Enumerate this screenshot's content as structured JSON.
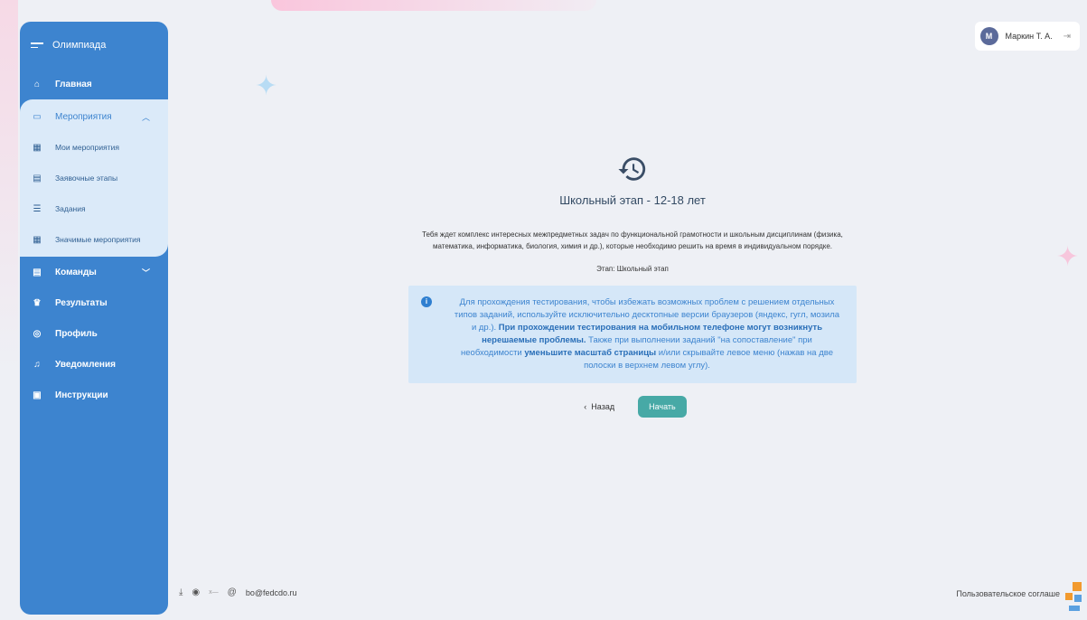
{
  "sidebar": {
    "app_title": "Олимпиада",
    "main_item": "Главная",
    "events": {
      "label": "Мероприятия",
      "sub_items": [
        {
          "label": "Мои мероприятия",
          "icon": "calendar-grid-icon"
        },
        {
          "label": "Заявочные этапы",
          "icon": "calendar-list-icon"
        },
        {
          "label": "Задания",
          "icon": "tasks-list-icon"
        },
        {
          "label": "Значимые мероприятия",
          "icon": "calendar-star-icon"
        }
      ]
    },
    "items": [
      {
        "label": "Команды",
        "icon": "team-icon"
      },
      {
        "label": "Результаты",
        "icon": "trophy-icon"
      },
      {
        "label": "Профиль",
        "icon": "profile-icon"
      },
      {
        "label": "Уведомления",
        "icon": "bell-icon"
      },
      {
        "label": "Инструкции",
        "icon": "book-icon"
      }
    ]
  },
  "header": {
    "user_initial": "М",
    "user_name": "Маркин Т. А."
  },
  "main": {
    "title": "Школьный этап - 12-18 лет",
    "description": "Тебя ждет комплекс интересных межпредметных задач по функциональной грамотности и школьным дисциплинам (физика, математика, информатика, биология, химия и др.), которые необходимо решить на время в индивидуальном порядке.",
    "stage": "Этап: Школьный этап",
    "info": {
      "part1": "Для прохождения тестирования, чтобы избежать возможных проблем с решением отдельных типов заданий, используйте исключительно десктопные версии браузеров (яндекс, гугл, мозила и др.). ",
      "bold1": "При прохождении тестирования на мобильном телефоне могут возникнуть нерешаемые проблемы.",
      "part2": " Также при выполнении заданий \"на сопоставление\" при необходимости ",
      "bold2": "уменьшите масштаб страницы",
      "part3": " и/или скрывайте левое меню (нажав на две полоски в верхнем левом углу)."
    },
    "back_label": "Назад",
    "start_label": "Начать"
  },
  "footer": {
    "email": "bo@fedcdo.ru",
    "agreement": "Пользовательское соглаше"
  },
  "colors": {
    "sidebar": "#3d84cf",
    "sidebar_light": "#dbeaf9",
    "start_button": "#47a9a6",
    "info_bg": "#d5e7f8"
  }
}
